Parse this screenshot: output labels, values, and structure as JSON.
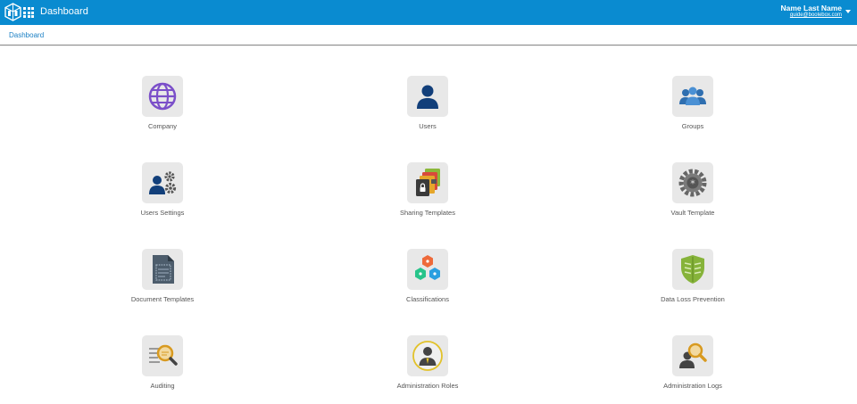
{
  "header": {
    "title": "Dashboard",
    "user_name": "Name Last Name",
    "user_email": "guide@boolebox.com",
    "brand_color": "#0a8bd0"
  },
  "breadcrumb": {
    "current": "Dashboard"
  },
  "tiles": [
    {
      "label": "Company",
      "icon": "globe-icon"
    },
    {
      "label": "Users",
      "icon": "user-icon"
    },
    {
      "label": "Groups",
      "icon": "group-icon"
    },
    {
      "label": "Users Settings",
      "icon": "user-settings-icon"
    },
    {
      "label": "Sharing Templates",
      "icon": "sharing-templates-icon"
    },
    {
      "label": "Vault Template",
      "icon": "vault-icon"
    },
    {
      "label": "Document Templates",
      "icon": "document-template-icon"
    },
    {
      "label": "Classifications",
      "icon": "classifications-icon"
    },
    {
      "label": "Data Loss Prevention",
      "icon": "shield-icon"
    },
    {
      "label": "Auditing",
      "icon": "auditing-icon"
    },
    {
      "label": "Administration Roles",
      "icon": "admin-roles-icon"
    },
    {
      "label": "Administration Logs",
      "icon": "admin-logs-icon"
    }
  ]
}
